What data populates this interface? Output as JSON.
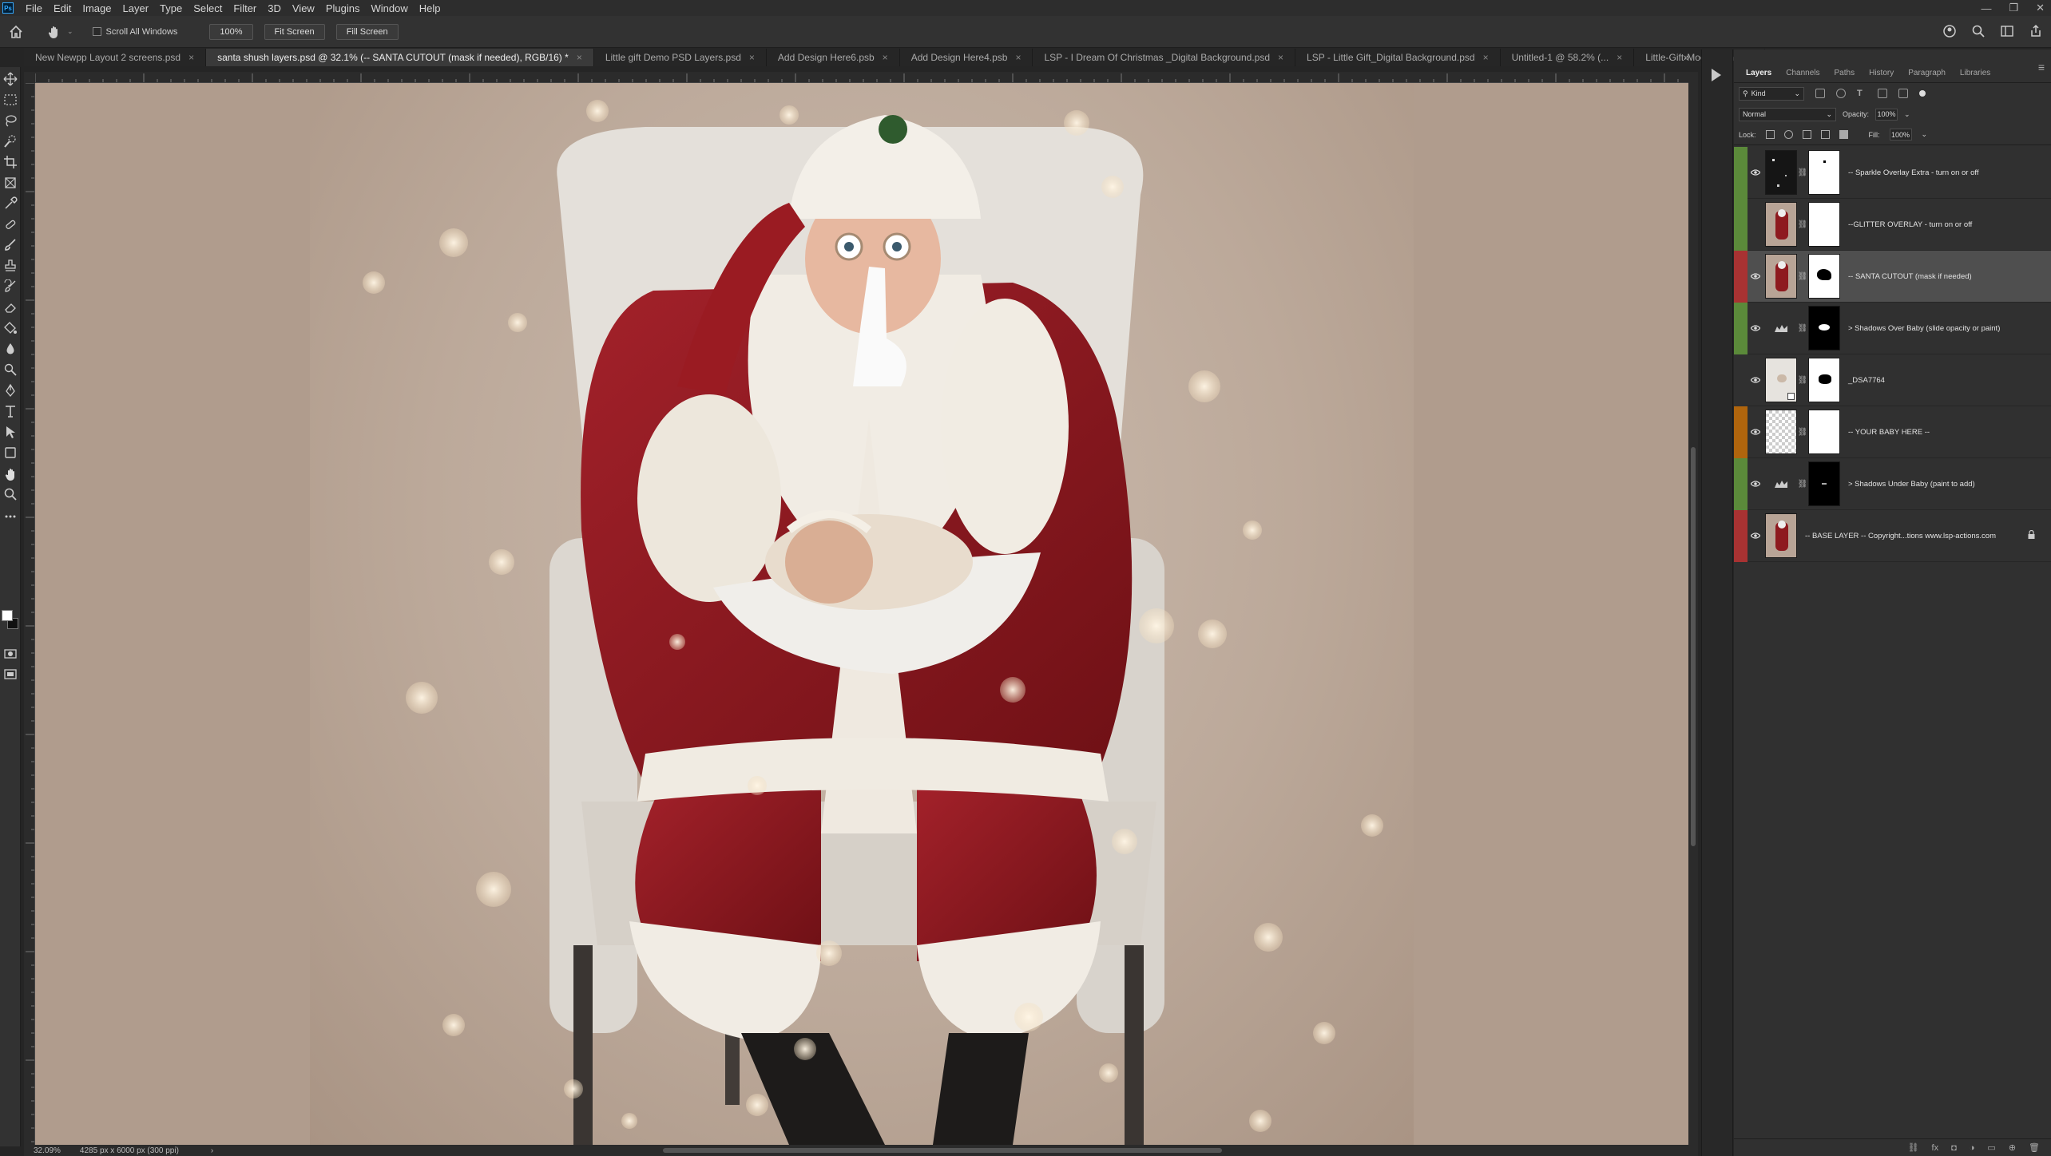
{
  "app": {
    "logo": "Ps"
  },
  "menu": [
    "File",
    "Edit",
    "Image",
    "Layer",
    "Type",
    "Select",
    "Filter",
    "3D",
    "View",
    "Plugins",
    "Window",
    "Help"
  ],
  "window_controls": [
    "—",
    "❐",
    "✕"
  ],
  "options": {
    "scroll_all_label": "Scroll All Windows",
    "zoom_btn": "100%",
    "fit_btn": "Fit Screen",
    "fill_btn": "Fill Screen"
  },
  "tabs": [
    {
      "label": "New Newpp Layout 2 screens.psd",
      "active": false
    },
    {
      "label": "santa shush layers.psd @ 32.1% (-- SANTA CUTOUT (mask if needed), RGB/16) *",
      "active": true
    },
    {
      "label": "Little gift Demo PSD Layers.psd",
      "active": false
    },
    {
      "label": "Add Design Here6.psb",
      "active": false
    },
    {
      "label": "Add Design Here4.psb",
      "active": false
    },
    {
      "label": "LSP - I Dream Of Christmas _Digital Background.psd",
      "active": false
    },
    {
      "label": "LSP - Little Gift_Digital Background.psd",
      "active": false
    },
    {
      "label": "Untitled-1 @ 58.2% (...",
      "active": false
    },
    {
      "label": "Little-Gift-Mockup.png",
      "active": false
    }
  ],
  "tab_more": "»",
  "status": {
    "zoom": "32.09%",
    "doc_info": "4285 px x 6000 px (300 ppi)",
    "arrow": "›"
  },
  "panel": {
    "tabs": [
      "Layers",
      "Channels",
      "Paths",
      "History",
      "Paragraph",
      "Libraries"
    ],
    "active_tab": "Layers",
    "menu_icon": "≡",
    "filter_kind": "Kind",
    "blend_mode": "Normal",
    "opacity_label": "Opacity:",
    "opacity_value": "100%",
    "lock_label": "Lock:",
    "fill_label": "Fill:",
    "fill_value": "100%"
  },
  "layers": [
    {
      "name": "-- Sparkle Overlay Extra - turn on or off",
      "color": "#5b8a3a",
      "visible": true,
      "thumb": "sparkle",
      "mask": "white-dot",
      "selected": false,
      "locked": false
    },
    {
      "name": "--GLITTER OVERLAY - turn on or off",
      "color": "#5b8a3a",
      "visible": false,
      "thumb": "photo",
      "mask": "white",
      "selected": false,
      "locked": false
    },
    {
      "name": "-- SANTA CUTOUT (mask if needed)",
      "color": "#a83232",
      "visible": true,
      "thumb": "photo",
      "mask": "white-blob",
      "selected": true,
      "locked": false
    },
    {
      "name": "> Shadows Over Baby (slide opacity or paint)",
      "color": "#5b8a3a",
      "visible": true,
      "thumb": "adjust",
      "mask": "black-blob",
      "selected": false,
      "locked": false
    },
    {
      "name": "_DSA7764",
      "color": "#303030",
      "visible": true,
      "thumb": "smart",
      "mask": "white-blackblob",
      "selected": false,
      "locked": false
    },
    {
      "name": "-- YOUR BABY HERE --",
      "color": "#b0650d",
      "visible": true,
      "thumb": "transparent",
      "mask": "white",
      "selected": false,
      "locked": false
    },
    {
      "name": "> Shadows Under Baby (paint to add)",
      "color": "#5b8a3a",
      "visible": true,
      "thumb": "adjust",
      "mask": "black-dot",
      "selected": false,
      "locked": false
    },
    {
      "name": "-- BASE LAYER -- Copyright...tions www.lsp-actions.com",
      "color": "#a83232",
      "visible": true,
      "thumb": "photo",
      "mask": "none",
      "selected": false,
      "locked": true
    }
  ],
  "footer_icons": [
    "link-icon",
    "fx-icon",
    "mask-icon",
    "adjustment-icon",
    "group-icon",
    "new-layer-icon",
    "trash-icon"
  ],
  "footer_glyphs": [
    "⛓",
    "fx",
    "◘",
    "◑",
    "▭",
    "⊕",
    "🗑"
  ],
  "colors": {
    "accent_selected": "#4f4f4f",
    "canvas_bg": "#bca99a",
    "santa_red": "#8e1a1f",
    "fur": "#efe9e0"
  }
}
